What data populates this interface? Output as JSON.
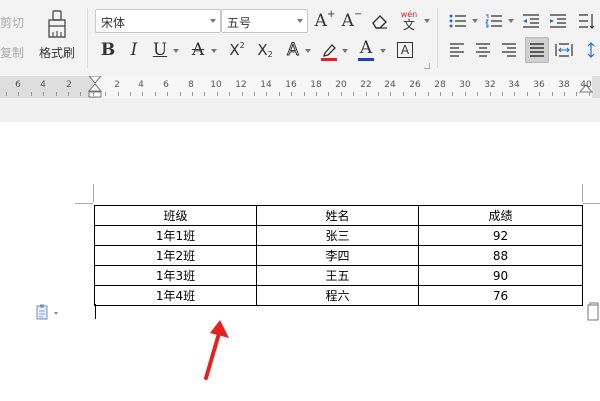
{
  "clipboard": {
    "cut_label": "剪切",
    "copy_label": "复制"
  },
  "format_painter": {
    "label": "格式刷"
  },
  "font": {
    "name": "宋体",
    "size": "五号"
  },
  "toolbar": {
    "bold": "B",
    "italic": "I",
    "underline": "U",
    "strikethrough": "A",
    "superscript_base": "X",
    "superscript_mark": "2",
    "subscript_base": "X",
    "subscript_mark": "2",
    "text_effect": "A",
    "font_color": "A",
    "char_border": "A",
    "grow_font": "A",
    "shrink_font": "A",
    "phonetic": "wén",
    "colors": {
      "underline_red": "#e02020",
      "font_blue": "#1f3fc8",
      "highlight_red": "#e02020"
    }
  },
  "ruler": {
    "labels": [
      "6",
      "4",
      "2",
      "2",
      "4",
      "6",
      "8",
      "10",
      "12",
      "14",
      "16",
      "18",
      "20",
      "22",
      "24",
      "26",
      "28",
      "30",
      "32",
      "34",
      "36",
      "38",
      "40"
    ]
  },
  "table": {
    "headers": [
      "班级",
      "姓名",
      "成绩"
    ],
    "rows": [
      [
        "1年1班",
        "张三",
        "92"
      ],
      [
        "1年2班",
        "李四",
        "88"
      ],
      [
        "1年3班",
        "王五",
        "90"
      ],
      [
        "1年4班",
        "程六",
        "76"
      ]
    ]
  },
  "annotation": {
    "arrow_color": "#e52222"
  }
}
